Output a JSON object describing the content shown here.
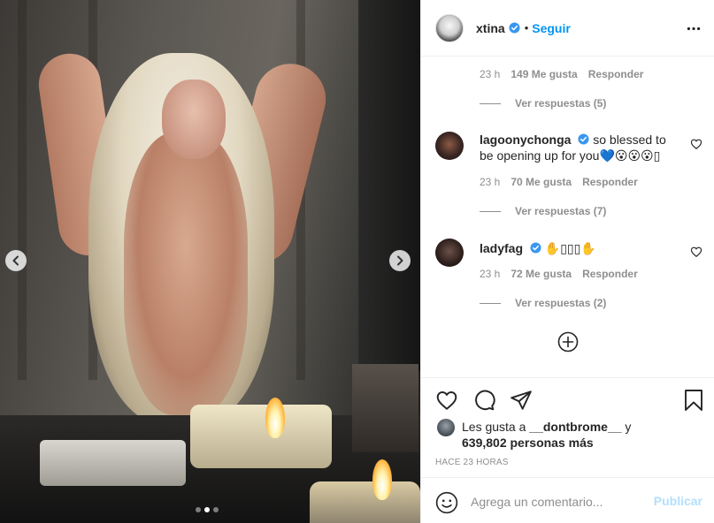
{
  "post": {
    "image_alt": "photo",
    "carousel": {
      "count": 3,
      "active_index": 1
    }
  },
  "header": {
    "username": "xtina",
    "verified": true,
    "separator": "•",
    "follow_label": "Seguir"
  },
  "comments": {
    "first_meta": {
      "time": "23 h",
      "likes": "149 Me gusta",
      "reply": "Responder"
    },
    "first_view_replies": "Ver respuestas (5)",
    "items": [
      {
        "username": "lagoonychonga",
        "text": "so blessed to be opening up for you💙😮😮😮▯",
        "time": "23 h",
        "likes": "70 Me gusta",
        "reply": "Responder",
        "view_replies": "Ver respuestas (7)"
      },
      {
        "username": "ladyfag",
        "text": "✋▯▯▯✋",
        "time": "23 h",
        "likes": "72 Me gusta",
        "reply": "Responder",
        "view_replies": "Ver respuestas (2)"
      }
    ]
  },
  "likes": {
    "prefix": "Les gusta a",
    "user": "__dontbrome__",
    "connector": "y",
    "count": "639,802",
    "suffix": "personas más"
  },
  "timestamp": "HACE 23 HORAS",
  "add_comment": {
    "placeholder": "Agrega un comentario...",
    "publish_label": "Publicar"
  },
  "colors": {
    "accent": "#0095f6",
    "publish_disabled": "#b2dffc",
    "verified": "#3897f0",
    "muted": "#8e8e8e"
  },
  "icons": [
    "heart-icon",
    "comment-icon",
    "share-icon",
    "save-icon",
    "emoji-icon",
    "more-icon",
    "chevron-left-icon",
    "chevron-right-icon",
    "add-circle-icon",
    "verified-icon"
  ]
}
